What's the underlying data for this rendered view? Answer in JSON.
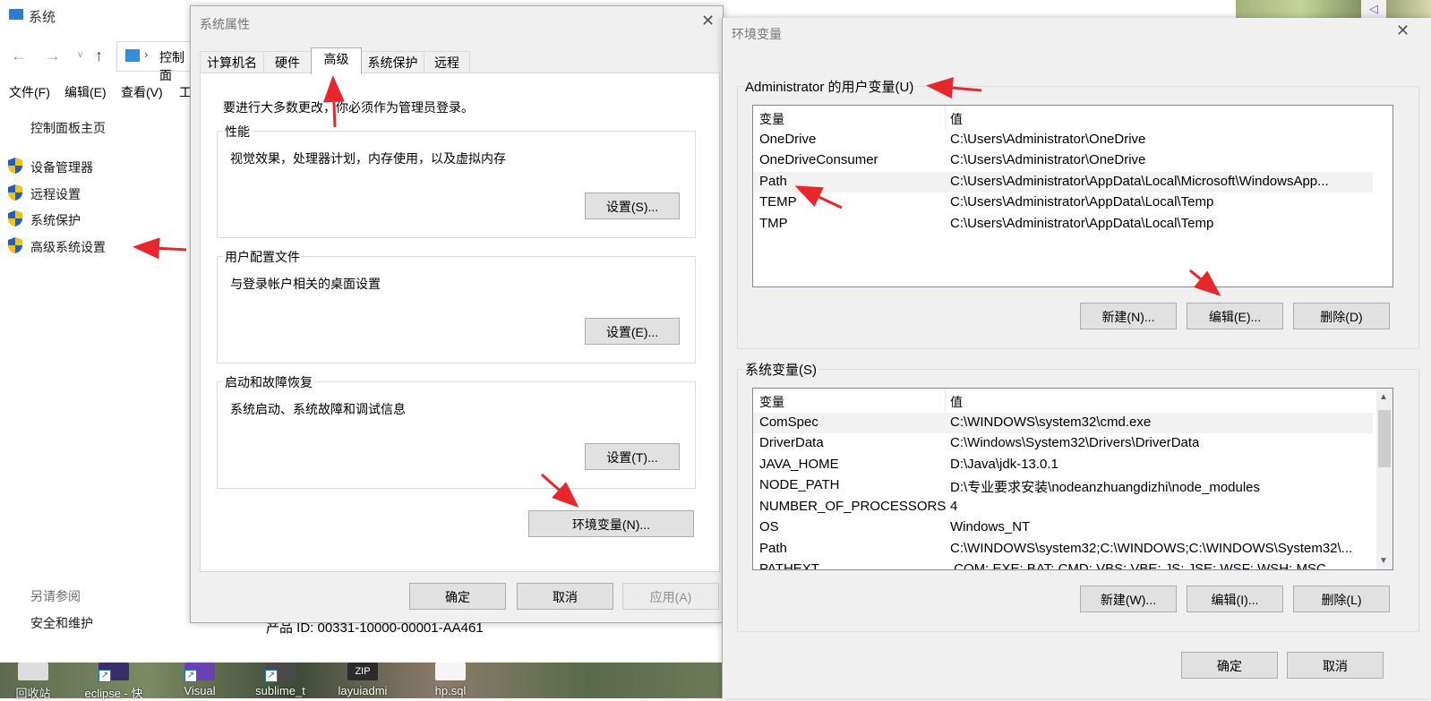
{
  "system_window": {
    "title": "系统",
    "address": "控制面",
    "menu": [
      "文件(F)",
      "编辑(E)",
      "查看(V)",
      "工"
    ],
    "home_link": "控制面板主页",
    "links": [
      "设备管理器",
      "远程设置",
      "系统保护",
      "高级系统设置"
    ],
    "see_also_title": "另请参阅",
    "see_also_link": "安全和维护",
    "product_id": "产品 ID: 00331-10000-00001-AA461"
  },
  "system_properties": {
    "title": "系统属性",
    "tabs": [
      "计算机名",
      "硬件",
      "高级",
      "系统保护",
      "远程"
    ],
    "active_tab": "高级",
    "admin_note": "要进行大多数更改，你必须作为管理员登录。",
    "performance": {
      "title": "性能",
      "desc": "视觉效果，处理器计划，内存使用，以及虚拟内存",
      "button": "设置(S)..."
    },
    "user_profiles": {
      "title": "用户配置文件",
      "desc": "与登录帐户相关的桌面设置",
      "button": "设置(E)..."
    },
    "startup": {
      "title": "启动和故障恢复",
      "desc": "系统启动、系统故障和调试信息",
      "button": "设置(T)..."
    },
    "env_button": "环境变量(N)...",
    "ok": "确定",
    "cancel": "取消",
    "apply": "应用(A)"
  },
  "env_vars": {
    "title": "环境变量",
    "user_group_title": "Administrator 的用户变量(U)",
    "col_var": "变量",
    "col_val": "值",
    "user_vars": [
      {
        "name": "OneDrive",
        "value": "C:\\Users\\Administrator\\OneDrive"
      },
      {
        "name": "OneDriveConsumer",
        "value": "C:\\Users\\Administrator\\OneDrive"
      },
      {
        "name": "Path",
        "value": "C:\\Users\\Administrator\\AppData\\Local\\Microsoft\\WindowsApp..."
      },
      {
        "name": "TEMP",
        "value": "C:\\Users\\Administrator\\AppData\\Local\\Temp"
      },
      {
        "name": "TMP",
        "value": "C:\\Users\\Administrator\\AppData\\Local\\Temp"
      }
    ],
    "user_buttons": {
      "new": "新建(N)...",
      "edit": "编辑(E)...",
      "delete": "删除(D)"
    },
    "sys_group_title": "系统变量(S)",
    "sys_vars": [
      {
        "name": "ComSpec",
        "value": "C:\\WINDOWS\\system32\\cmd.exe"
      },
      {
        "name": "DriverData",
        "value": "C:\\Windows\\System32\\Drivers\\DriverData"
      },
      {
        "name": "JAVA_HOME",
        "value": "D:\\Java\\jdk-13.0.1"
      },
      {
        "name": "NODE_PATH",
        "value": "D:\\专业要求安装\\nodeanzhuangdizhi\\node_modules"
      },
      {
        "name": "NUMBER_OF_PROCESSORS",
        "value": "4"
      },
      {
        "name": "OS",
        "value": "Windows_NT"
      },
      {
        "name": "Path",
        "value": "C:\\WINDOWS\\system32;C:\\WINDOWS;C:\\WINDOWS\\System32\\..."
      },
      {
        "name": "PATHEXT",
        "value": ".COM;.EXE;.BAT;.CMD;.VBS;.VBE;.JS;.JSE;.WSF;.WSH;.MSC"
      }
    ],
    "sys_buttons": {
      "new": "新建(W)...",
      "edit": "编辑(I)...",
      "delete": "删除(L)"
    },
    "ok": "确定",
    "cancel": "取消"
  },
  "desktop_icons": [
    "回收站",
    "eclipse - 快",
    "Visual",
    "sublime_t",
    "layuiadmi",
    "hp.sql"
  ],
  "colors": {
    "shield_blue": "#1f5fbf",
    "shield_yellow": "#f4c20d",
    "arrow_red": "#e8272c",
    "link_text": "#1a1a1a"
  }
}
